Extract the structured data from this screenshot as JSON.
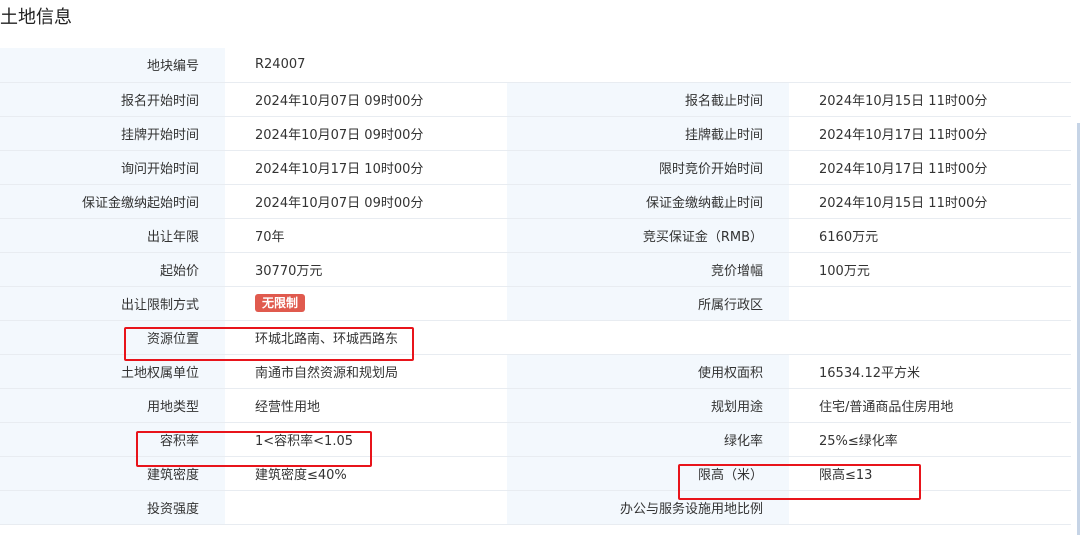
{
  "page": {
    "title": "土地信息"
  },
  "rows": [
    {
      "l1": "地块编号",
      "v1": "R24007"
    },
    {
      "l1": "报名开始时间",
      "v1": "2024年10月07日 09时00分",
      "l2": "报名截止时间",
      "v2": "2024年10月15日 11时00分"
    },
    {
      "l1": "挂牌开始时间",
      "v1": "2024年10月07日 09时00分",
      "l2": "挂牌截止时间",
      "v2": "2024年10月17日 11时00分"
    },
    {
      "l1": "询问开始时间",
      "v1": "2024年10月17日 10时00分",
      "l2": "限时竞价开始时间",
      "v2": "2024年10月17日 11时00分"
    },
    {
      "l1": "保证金缴纳起始时间",
      "v1": "2024年10月07日 09时00分",
      "l2": "保证金缴纳截止时间",
      "v2": "2024年10月15日 11时00分"
    },
    {
      "l1": "出让年限",
      "v1": "70年",
      "l2": "竞买保证金（RMB）",
      "v2": "6160万元"
    },
    {
      "l1": "起始价",
      "v1": "30770万元",
      "l2": "竞价增幅",
      "v2": "100万元"
    },
    {
      "l1": "出让限制方式",
      "v1": "无限制",
      "l2": "所属行政区",
      "v2": ""
    },
    {
      "l1": "资源位置",
      "v1": "环城北路南、环城西路东"
    },
    {
      "l1": "土地权属单位",
      "v1": "南通市自然资源和规划局",
      "l2": "使用权面积",
      "v2": "16534.12平方米"
    },
    {
      "l1": "用地类型",
      "v1": "经营性用地",
      "l2": "规划用途",
      "v2": "住宅/普通商品住房用地"
    },
    {
      "l1": "容积率",
      "v1": "1<容积率<1.05",
      "l2": "绿化率",
      "v2": "25%≤绿化率"
    },
    {
      "l1": "建筑密度",
      "v1": "建筑密度≤40%",
      "l2": "限高（米）",
      "v2": "限高≤13"
    },
    {
      "l1": "投资强度",
      "v1": "",
      "l2": "办公与服务设施用地比例",
      "v2": ""
    }
  ],
  "colors": {
    "label_bg": "#f3f8fd",
    "highlight": "#e8141b",
    "badge": "#e05a4e"
  }
}
